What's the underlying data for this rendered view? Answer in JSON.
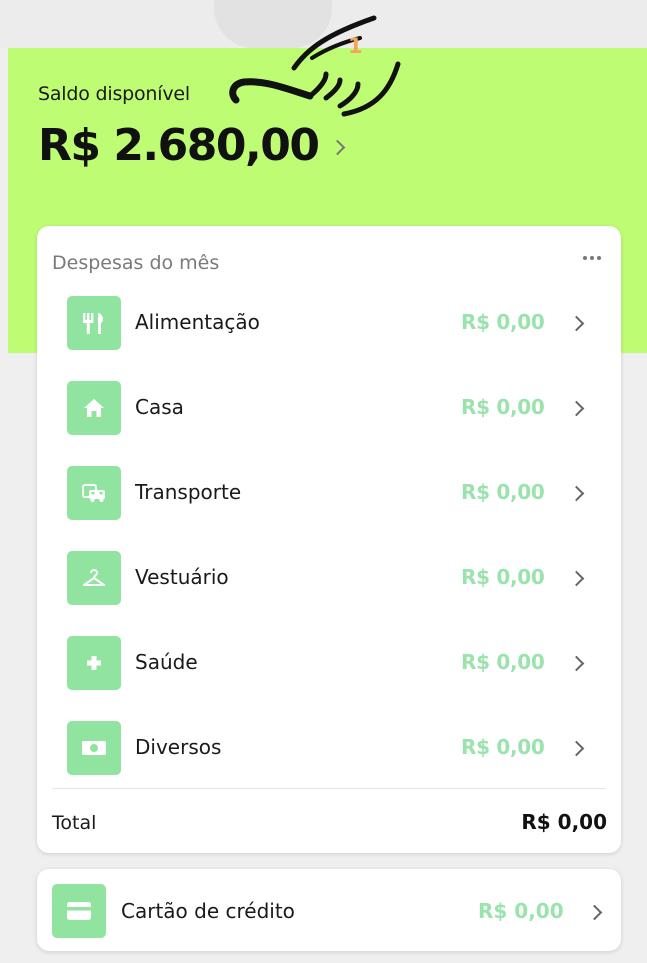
{
  "header": {
    "balance_label": "Saldo disponível",
    "balance_value": "R$ 2.680,00",
    "step_badge": "1"
  },
  "colors": {
    "hero_background": "#befd73",
    "icon_background": "#91e3a0",
    "amount_text": "#9be3ad",
    "badge": "#f4a55c"
  },
  "expenses": {
    "title": "Despesas do mês",
    "items": [
      {
        "label": "Alimentação",
        "amount": "R$ 0,00",
        "icon": "fork-knife-icon"
      },
      {
        "label": "Casa",
        "amount": "R$ 0,00",
        "icon": "house-icon"
      },
      {
        "label": "Transporte",
        "amount": "R$ 0,00",
        "icon": "car-icon"
      },
      {
        "label": "Vestuário",
        "amount": "R$ 0,00",
        "icon": "hanger-icon"
      },
      {
        "label": "Saúde",
        "amount": "R$ 0,00",
        "icon": "health-cross-icon"
      },
      {
        "label": "Diversos",
        "amount": "R$ 0,00",
        "icon": "money-icon"
      }
    ],
    "total_label": "Total",
    "total_value": "R$ 0,00"
  },
  "credit_card": {
    "label": "Cartão de crédito",
    "amount": "R$ 0,00",
    "icon": "credit-card-icon"
  }
}
